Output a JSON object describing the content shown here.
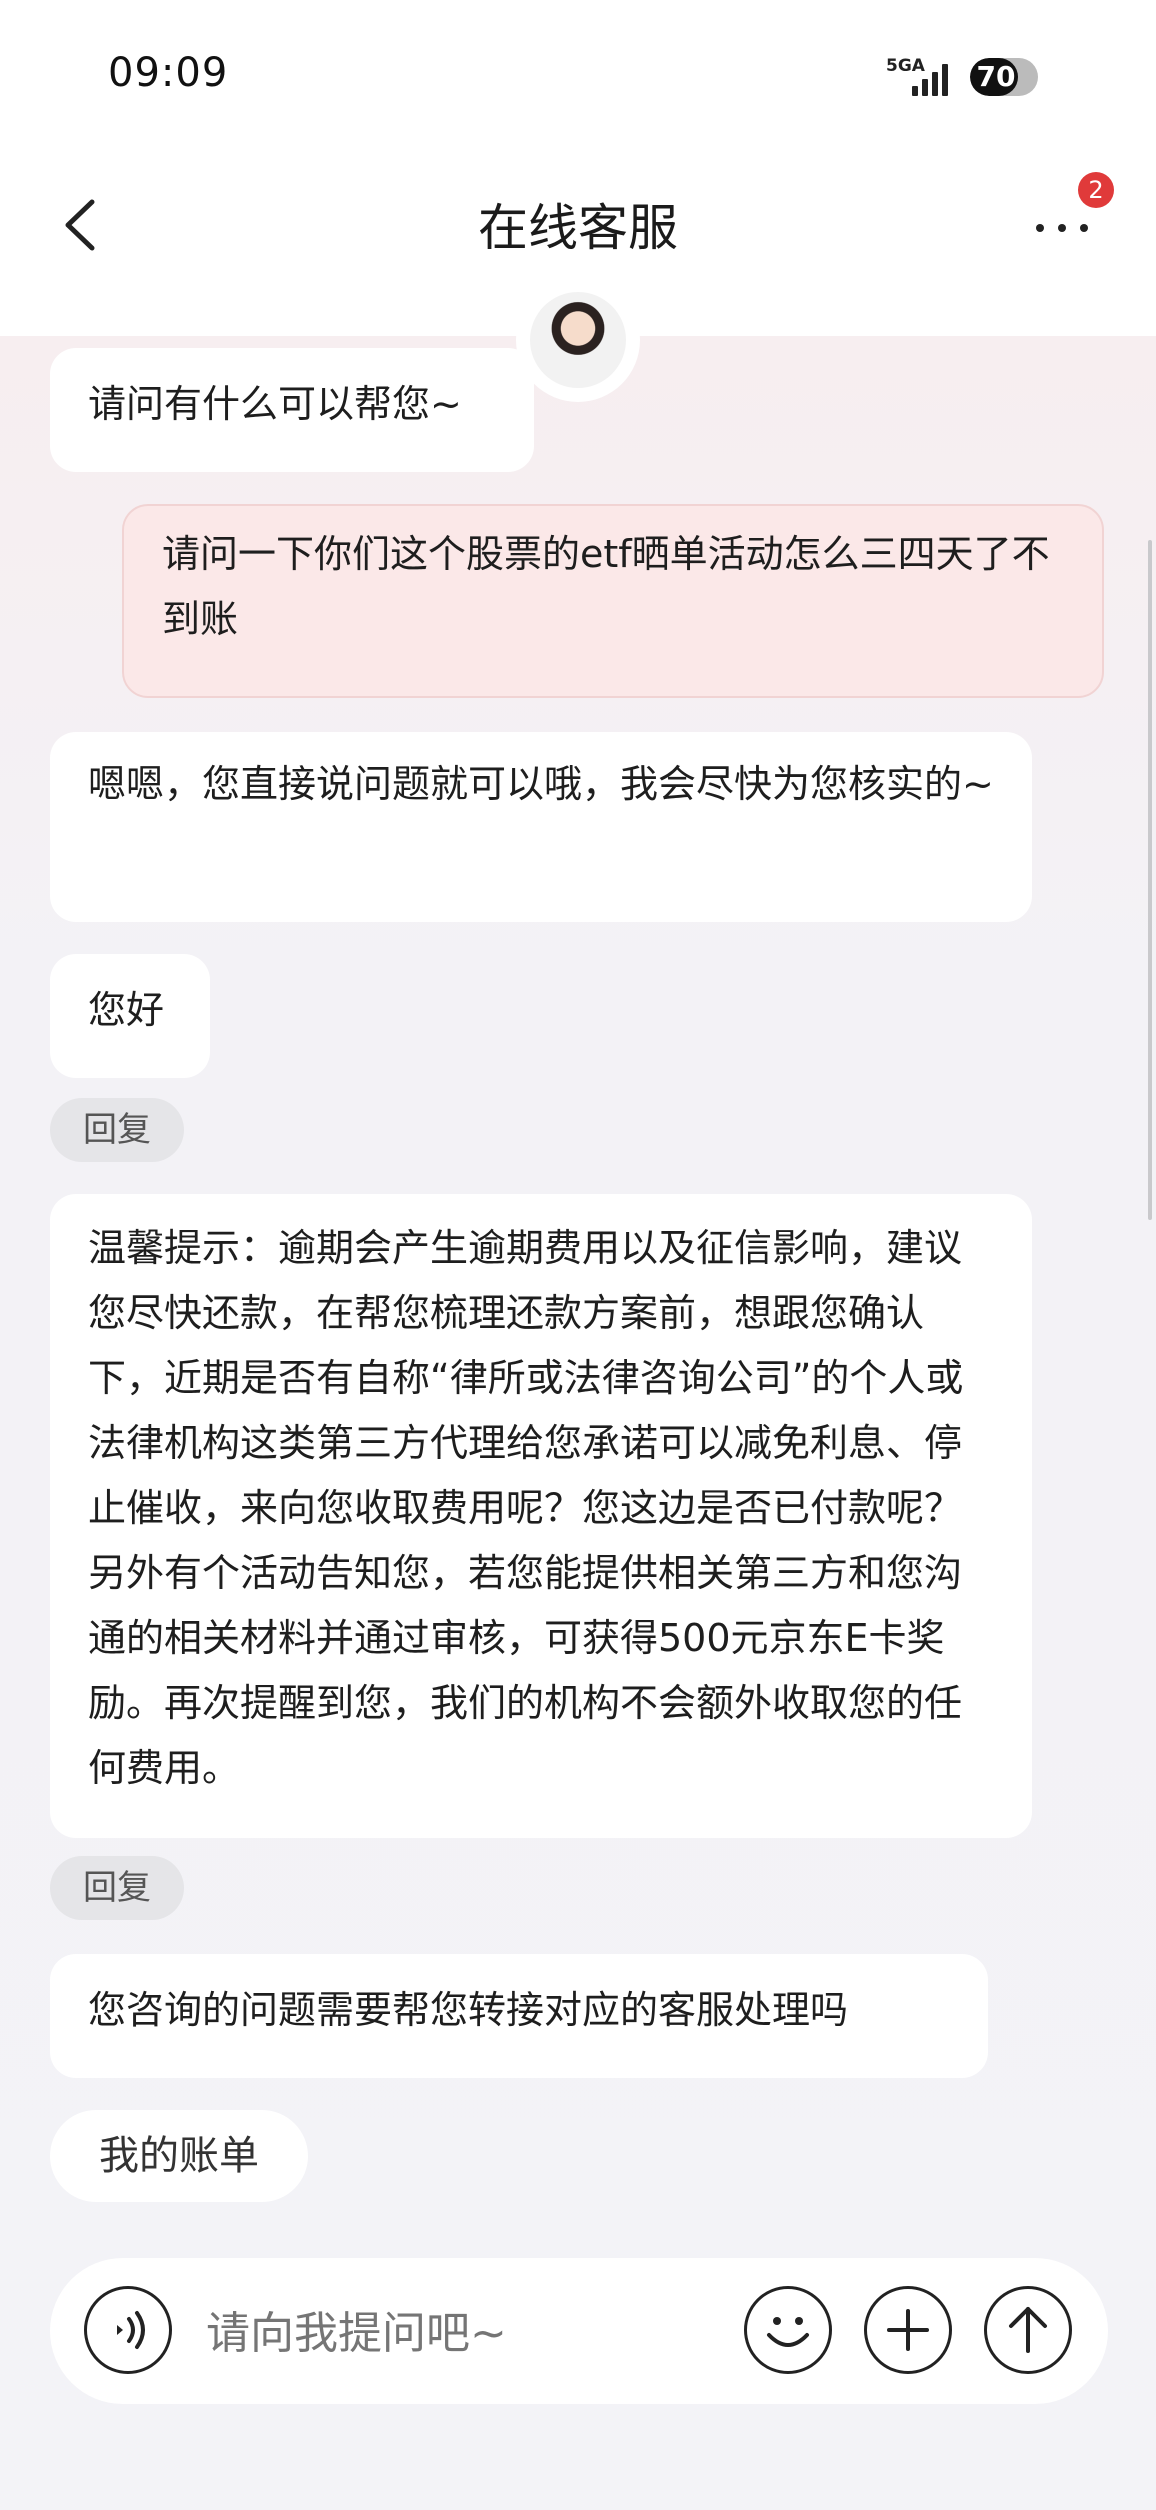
{
  "status": {
    "time": "09:09",
    "network": "5GA",
    "battery": "70"
  },
  "nav": {
    "title": "在线客服",
    "badge_count": "2"
  },
  "messages": [
    {
      "from": "agent",
      "text": "请问有什么可以帮您~"
    },
    {
      "from": "user",
      "text": "请问一下你们这个股票的etf晒单活动怎么三四天了不到账"
    },
    {
      "from": "agent",
      "text": "嗯嗯，您直接说问题就可以哦，我会尽快为您核实的~"
    },
    {
      "from": "agent",
      "text": "您好"
    },
    {
      "from": "agent",
      "text": "温馨提示：逾期会产生逾期费用以及征信影响，建议您尽快还款，在帮您梳理还款方案前，想跟您确认下，近期是否有自称“律所或法律咨询公司”的个人或法律机构这类第三方代理给您承诺可以减免利息、停止催收，来向您收取费用呢？您这边是否已付款呢？另外有个活动告知您，若您能提供相关第三方和您沟通的相关材料并通过审核，可获得500元京东E卡奖励。再次提醒到您，我们的机构不会额外收取您的任何费用。"
    },
    {
      "from": "agent",
      "text": "您咨询的问题需要帮您转接对应的客服处理吗"
    }
  ],
  "reply_label": "回复",
  "quick_chip": "我的账单",
  "input": {
    "placeholder": "请向我提问吧~"
  },
  "icons": {
    "back": "chevron-left-icon",
    "more": "more-dots-icon",
    "voice": "voice-icon",
    "emoji": "emoji-icon",
    "plus": "plus-icon",
    "send": "arrow-up-icon"
  },
  "colors": {
    "badge": "#e03a3a",
    "user_bubble": "#fbe8e8"
  }
}
